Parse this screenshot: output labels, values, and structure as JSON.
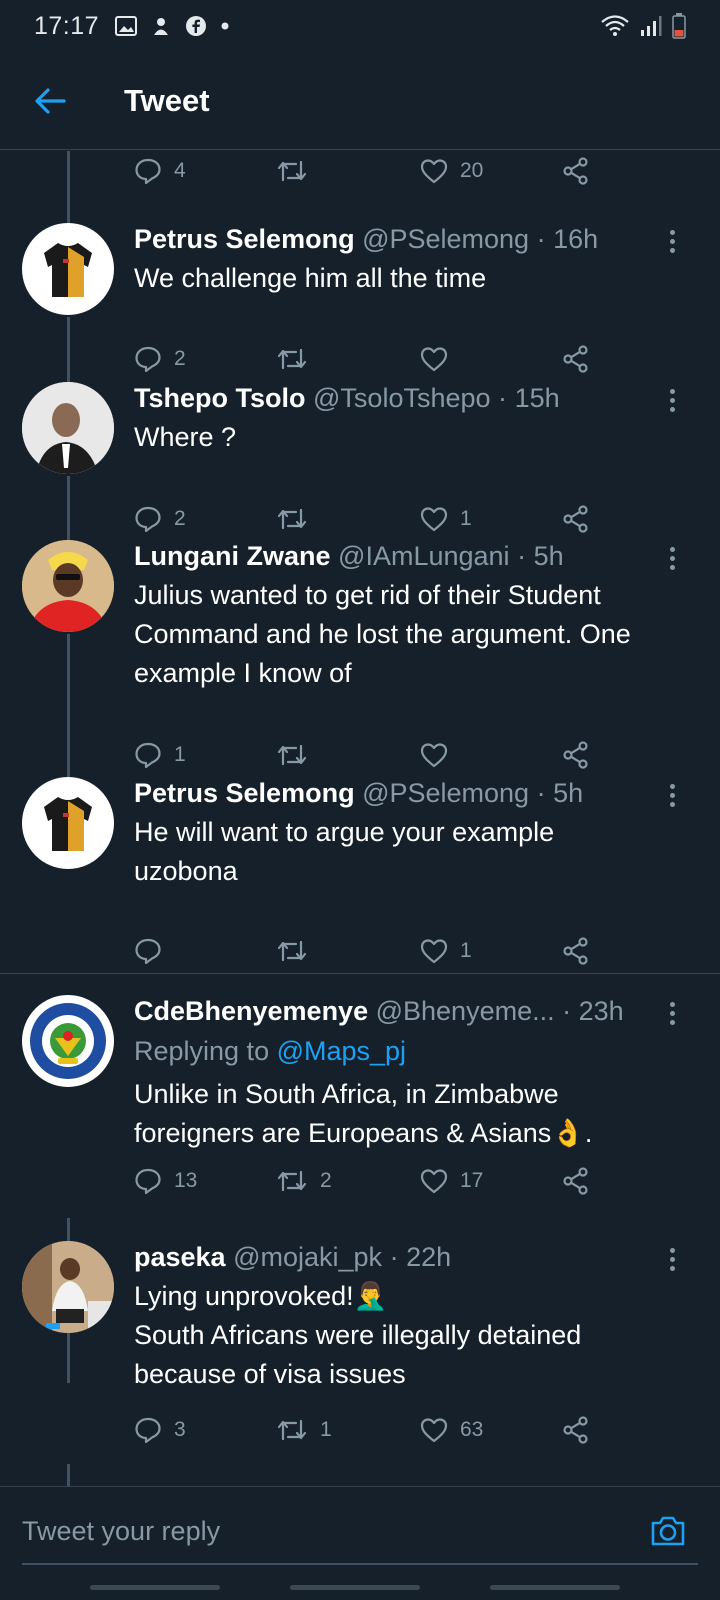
{
  "status": {
    "time": "17:17",
    "notification_icons": [
      "gallery-icon",
      "download-icon",
      "facebook-icon",
      "dot-icon"
    ],
    "right_icons": [
      "wifi-icon",
      "signal-icon",
      "battery-icon"
    ]
  },
  "header": {
    "title": "Tweet",
    "back_icon": "arrow-left-icon"
  },
  "top_actions": {
    "reply_count": "4",
    "retweet_count": "",
    "like_count": "20"
  },
  "tweets": [
    {
      "name": "Petrus Selemong",
      "handle": "@PSelemong",
      "time": "16h",
      "text": "We challenge him all the time",
      "reply_count": "2",
      "retweet_count": "",
      "like_count": ""
    },
    {
      "name": "Tshepo Tsolo",
      "handle": "@TsoloTshepo",
      "time": "15h",
      "text": "Where ?",
      "reply_count": "2",
      "retweet_count": "",
      "like_count": "1"
    },
    {
      "name": "Lungani Zwane",
      "handle": "@IAmLungani",
      "time": "5h",
      "text_lines": [
        "Julius wanted to get rid of their Student",
        "Command and he lost the argument. One",
        "example I know of"
      ],
      "reply_count": "1",
      "retweet_count": "",
      "like_count": ""
    },
    {
      "name": "Petrus Selemong",
      "handle": "@PSelemong",
      "time": "5h",
      "text_lines": [
        "He will want to argue your example",
        "uzobona"
      ],
      "reply_count": "",
      "retweet_count": "",
      "like_count": "1"
    },
    {
      "name": "CdeBhenyemenye",
      "handle": "@Bhenyeme...",
      "time": "23h",
      "replying_prefix": "Replying to ",
      "replying_to": "@Maps_pj",
      "text_lines": [
        "Unlike in South Africa, in Zimbabwe",
        "foreigners are Europeans & Asians👌."
      ],
      "reply_count": "13",
      "retweet_count": "2",
      "like_count": "17"
    },
    {
      "name": "paseka",
      "handle": "@mojaki_pk",
      "time": "22h",
      "text_lines": [
        "Lying unprovoked!🤦‍♂️",
        "South Africans were illegally detained",
        "because of visa issues"
      ],
      "reply_count": "3",
      "retweet_count": "1",
      "like_count": "63"
    }
  ],
  "reply_box": {
    "placeholder": "Tweet your reply",
    "camera_icon": "camera-icon"
  },
  "colors": {
    "background": "#15202b",
    "accent": "#1da1f2",
    "muted": "#8899a6",
    "divider": "#38444d"
  }
}
